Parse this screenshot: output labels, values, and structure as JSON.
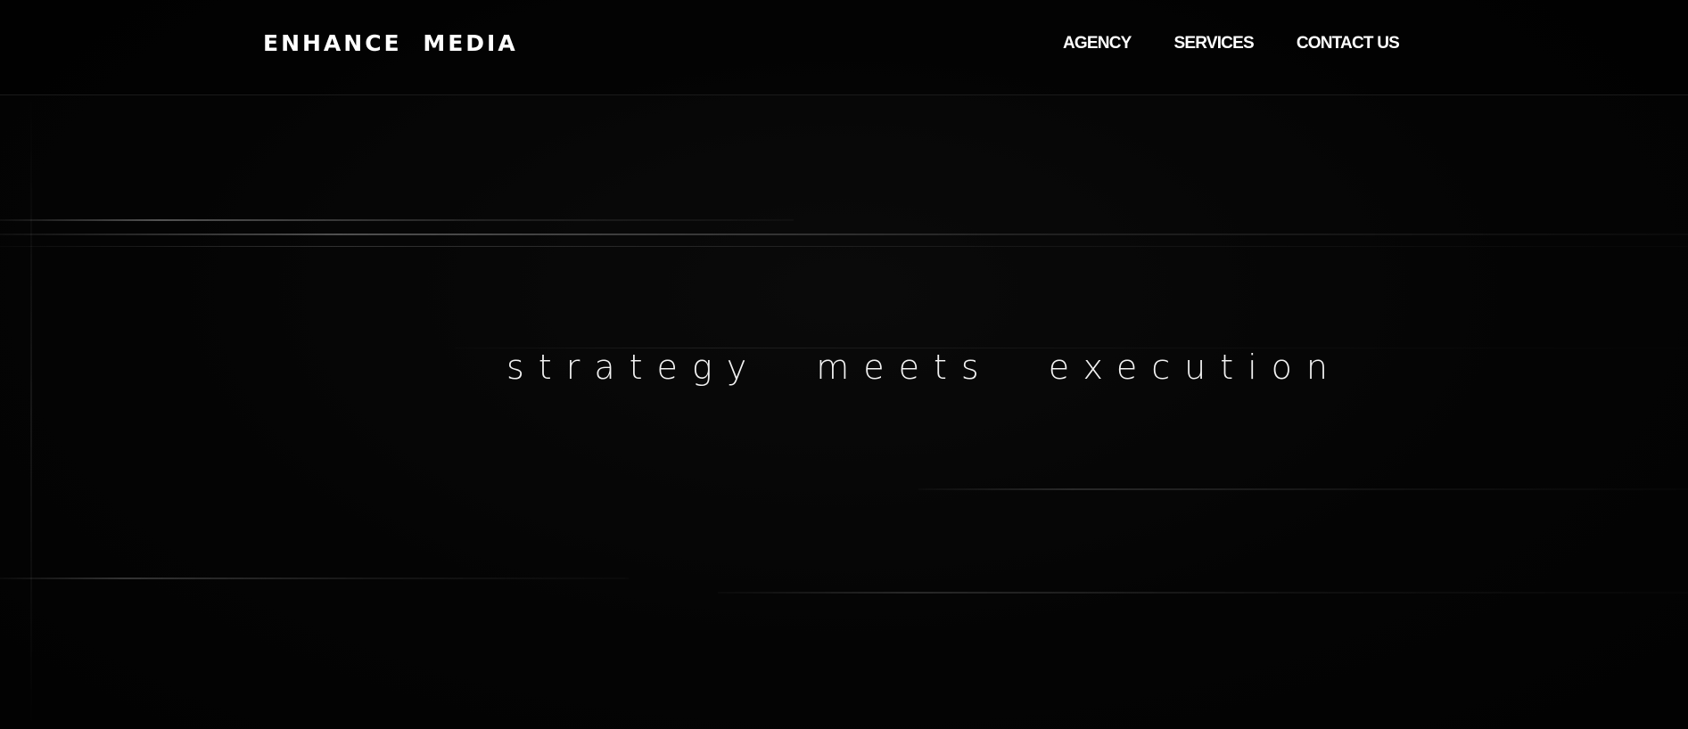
{
  "brand": {
    "logo_text": "ENHANCE MEDIA"
  },
  "nav": {
    "items": [
      {
        "label": "AGENCY"
      },
      {
        "label": "SERVICES"
      },
      {
        "label": "CONTACT US"
      }
    ]
  },
  "hero": {
    "tagline": "strategy meets execution"
  },
  "colors": {
    "background": "#050505",
    "text": "#ffffff"
  }
}
